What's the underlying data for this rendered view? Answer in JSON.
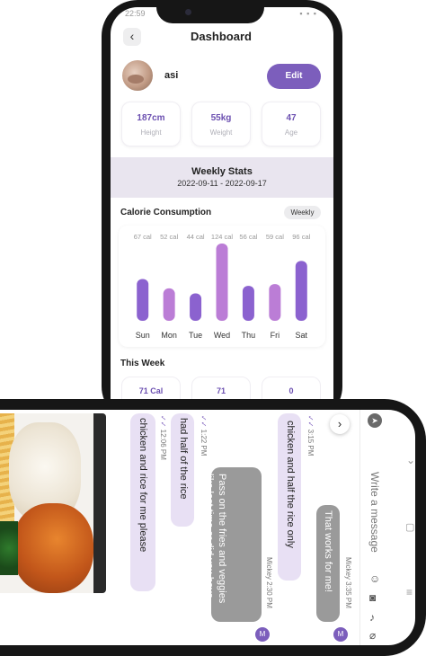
{
  "status_bar": {
    "time": "22:59",
    "icons": "▪ ▪ ▪"
  },
  "dashboard": {
    "title": "Dashboard",
    "back_icon": "chevron-left-icon",
    "user": {
      "name": "asi"
    },
    "edit_label": "Edit",
    "stats": [
      {
        "value": "187cm",
        "label": "Height"
      },
      {
        "value": "55kg",
        "label": "Weight"
      },
      {
        "value": "47",
        "label": "Age"
      }
    ],
    "weekly": {
      "title": "Weekly Stats",
      "range": "2022-09-11 - 2022-09-17"
    },
    "calorie": {
      "title": "Calorie Consumption",
      "filter": "Weekly"
    },
    "this_week": {
      "title": "This Week",
      "values": [
        "71 Cal",
        "71",
        "0"
      ]
    }
  },
  "chart_data": {
    "type": "bar",
    "title": "Calorie Consumption",
    "categories": [
      "Sun",
      "Mon",
      "Tue",
      "Wed",
      "Thu",
      "Fri",
      "Sat"
    ],
    "values": [
      67,
      52,
      44,
      124,
      56,
      59,
      96
    ],
    "data_labels": [
      "67 cal",
      "52 cal",
      "44 cal",
      "124 cal",
      "56 cal",
      "59 cal",
      "96 cal"
    ],
    "colors": [
      "#8b62cf",
      "#bb7dd6",
      "#8b62cf",
      "#bb7dd6",
      "#8b62cf",
      "#bb7dd6",
      "#8b62cf"
    ],
    "ylim": [
      0,
      124
    ],
    "grid": false
  },
  "chat": {
    "messages": [
      {
        "text": "chicken and rice for me please",
        "time": "12:06 PM",
        "from": "me"
      },
      {
        "text": "had half of the rice",
        "time": "1:22 PM",
        "from": "me"
      },
      {
        "text": "Pass on the fries and veggies like last time or did you have them?",
        "sender": "Mickey",
        "time": "2:30 PM",
        "from": "other"
      },
      {
        "text": "chicken and half the rice only",
        "time": "3:15 PM",
        "from": "me"
      },
      {
        "text": "That works for me!",
        "sender": "Mickey",
        "time": "3:35 PM",
        "from": "other"
      }
    ],
    "avatar_initial": "M",
    "input_placeholder": "Write a message",
    "colors": {
      "accent": "#7c5ebc",
      "my_bubble": "#e8e0f4",
      "other_bubble": "#9a9a9a"
    }
  }
}
